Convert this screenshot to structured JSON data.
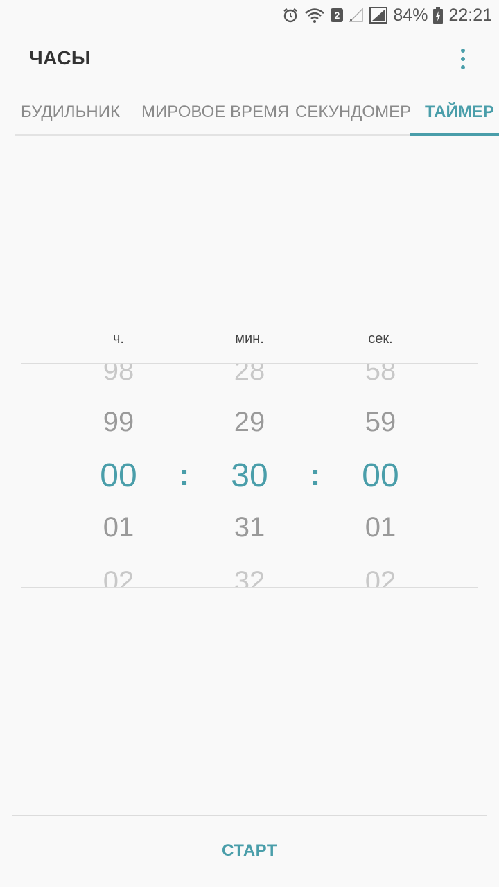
{
  "status_bar": {
    "battery_percent": "84%",
    "time": "22:21",
    "sim_slot": "2",
    "icons": [
      "alarm-icon",
      "wifi-icon",
      "sim-2-icon",
      "signal-empty-icon",
      "signal-icon",
      "battery-charging-icon"
    ]
  },
  "app": {
    "title": "ЧАСЫ",
    "accent_color": "#4a9eaa"
  },
  "tabs": [
    {
      "label": "БУДИЛЬНИК",
      "active": false
    },
    {
      "label": "МИРОВОЕ ВРЕМЯ",
      "active": false
    },
    {
      "label": "СЕКУНДОМЕР",
      "active": false
    },
    {
      "label": "ТАЙМЕР",
      "active": true
    }
  ],
  "timer": {
    "labels": {
      "hours": "ч.",
      "minutes": "мин.",
      "seconds": "сек."
    },
    "separator": ":",
    "hours": {
      "values": [
        "98",
        "99",
        "00",
        "01",
        "02"
      ],
      "selected": "00"
    },
    "minutes": {
      "values": [
        "28",
        "29",
        "30",
        "31",
        "32"
      ],
      "selected": "30"
    },
    "seconds": {
      "values": [
        "58",
        "59",
        "00",
        "01",
        "02"
      ],
      "selected": "00"
    }
  },
  "actions": {
    "start_label": "СТАРТ"
  }
}
